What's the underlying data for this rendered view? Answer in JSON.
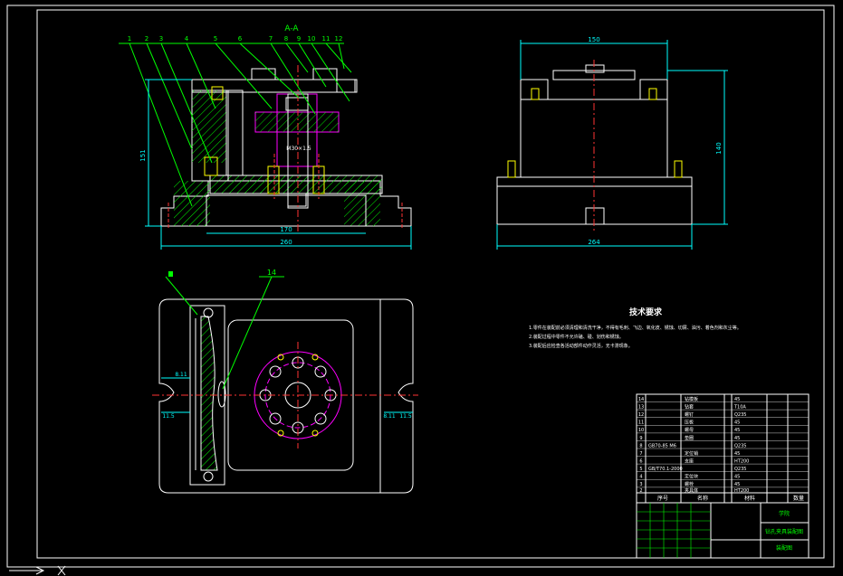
{
  "colors": {
    "background": "#000000",
    "line": "#ffffff",
    "frame": "#ffffff",
    "dim": "#00ffff",
    "hatch": "#00ff00",
    "center": "#ff3333",
    "part": "#ff00ff",
    "title_text": "#ffff00",
    "green_text": "#33ff33"
  },
  "front_view": {
    "section_label": "A-A",
    "part_labels": [
      "1",
      "2",
      "3",
      "4",
      "5",
      "6",
      "7",
      "8",
      "9",
      "10",
      "11",
      "12"
    ],
    "dims": {
      "height": "151",
      "inner_width": "170",
      "overall_width": "260",
      "thread_note": "M30×1.5"
    }
  },
  "side_view": {
    "dims": {
      "top_width": "150",
      "height": "140",
      "overall_width": "264"
    }
  },
  "plan_view": {
    "labels": {
      "part_13": "13",
      "part_14": "14"
    },
    "dims": {
      "left_slot": "8.11",
      "left_small": "11.5",
      "right_slot": "8.11",
      "right_small": "11.5"
    }
  },
  "technical_requirements": {
    "title": "技术要求",
    "items": [
      "1.零件在装配前必须清理和清洗干净，不得有毛刺、飞边、氧化皮、锈蚀、切屑、油污、着色剂和灰尘等。",
      "2.装配过程中零件不允许磕、碰、划伤和锈蚀。",
      "3.装配后应检查各活动部件动作灵活，无卡滞现象。"
    ]
  },
  "title_block": {
    "header": {
      "seq": "序号",
      "name": "名称",
      "material": "材料",
      "qty": "数量"
    },
    "drawing_name": "钻孔夹具装配图",
    "org": "学院",
    "sheet_label": "装配图",
    "rows": [
      {
        "no": "14",
        "name": "钻模板",
        "material": "45"
      },
      {
        "no": "13",
        "name": "钻套",
        "material": "T10A"
      },
      {
        "no": "12",
        "name": "螺钉",
        "material": "Q235"
      },
      {
        "no": "11",
        "name": "压板",
        "material": "45"
      },
      {
        "no": "10",
        "name": "螺母",
        "material": "45"
      },
      {
        "no": "9",
        "name": "垫圈",
        "material": "45"
      },
      {
        "no": "8",
        "name": "GB70-85 M6",
        "material": "Q235"
      },
      {
        "no": "7",
        "name": "定位销",
        "material": "45"
      },
      {
        "no": "6",
        "name": "支座",
        "material": "HT200"
      },
      {
        "no": "5",
        "name": "GB/T70.1-2000",
        "material": "Q235"
      },
      {
        "no": "4",
        "name": "定位块",
        "material": "45"
      },
      {
        "no": "3",
        "name": "螺栓",
        "material": "45"
      },
      {
        "no": "2",
        "name": "夹具体",
        "material": "HT200"
      },
      {
        "no": "1",
        "name": "底座",
        "material": "HT200"
      }
    ]
  }
}
